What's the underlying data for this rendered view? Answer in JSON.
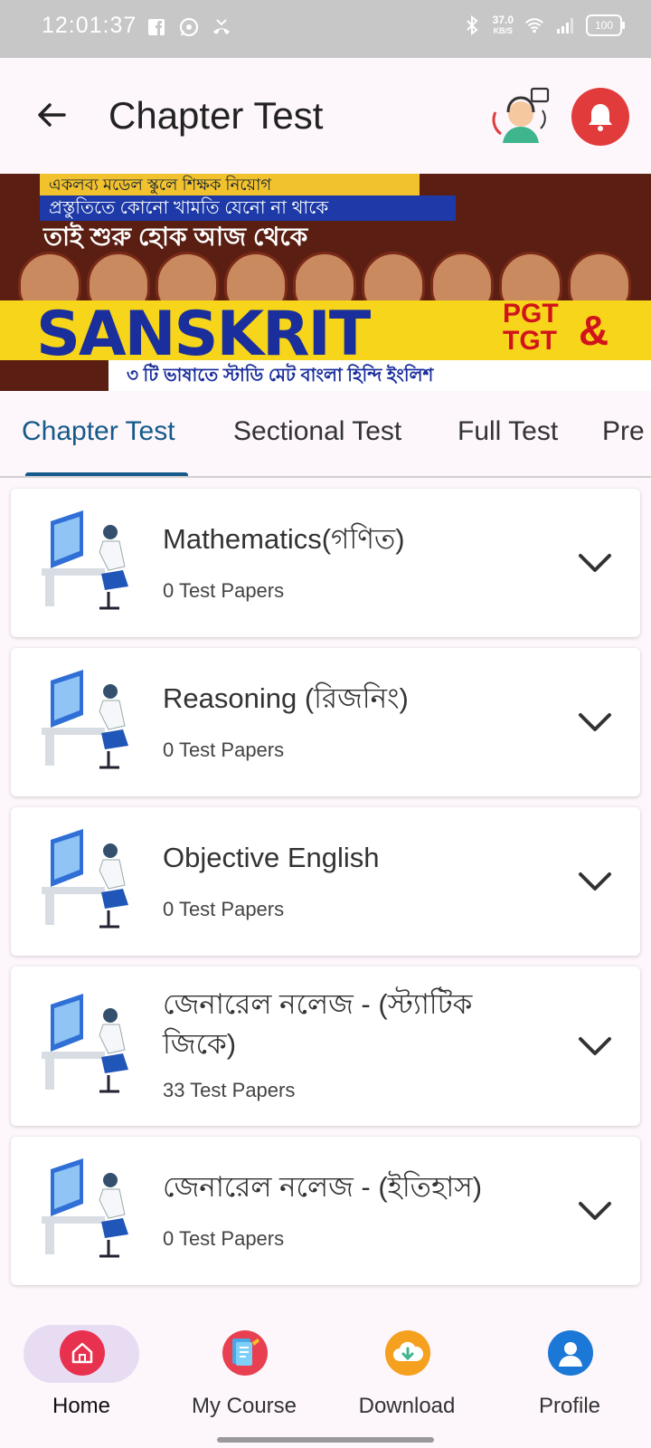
{
  "status_bar": {
    "time": "12:01:37",
    "net_speed_value": "37.0",
    "net_speed_unit": "KB/S",
    "battery": "100"
  },
  "app_bar": {
    "title": "Chapter Test"
  },
  "banner": {
    "line1": "একলব্য মডেল স্কুলে শিক্ষক নিয়োগ",
    "line2": "প্রস্তুতিতে কোনো খামতি যেনো না থাকে",
    "line3": "তাই শুরু হোক আজ থেকে",
    "headline": "SANSKRIT",
    "pgt": "PGT",
    "tgt": "TGT",
    "amp": "&",
    "bottom": "৩ টি ভাষাতে স্টাডি মেট বাংলা হিন্দি ইংলিশ"
  },
  "tabs": [
    {
      "label": "Chapter Test"
    },
    {
      "label": "Sectional Test"
    },
    {
      "label": "Full Test"
    },
    {
      "label": "Pre"
    }
  ],
  "subjects": [
    {
      "title": "Mathematics(গণিত)",
      "papers": "0 Test Papers"
    },
    {
      "title": "Reasoning (রিজনিং)",
      "papers": "0 Test Papers"
    },
    {
      "title": "Objective English",
      "papers": "0 Test Papers"
    },
    {
      "title": "জেনারেল নলেজ - (স্ট্যাটিক জিকে)",
      "papers": "33 Test Papers"
    },
    {
      "title": "জেনারেল নলেজ - (ইতিহাস)",
      "papers": "0 Test Papers"
    }
  ],
  "bottom_nav": [
    {
      "label": "Home",
      "icon": "home-icon",
      "color": "#e8304f"
    },
    {
      "label": "My Course",
      "icon": "book-icon",
      "color": "#e84050"
    },
    {
      "label": "Download",
      "icon": "cloud-download-icon",
      "color": "#f5a01e"
    },
    {
      "label": "Profile",
      "icon": "user-icon",
      "color": "#1b78d6"
    }
  ],
  "colors": {
    "accent": "#145a8a",
    "bell": "#e23b3b"
  }
}
